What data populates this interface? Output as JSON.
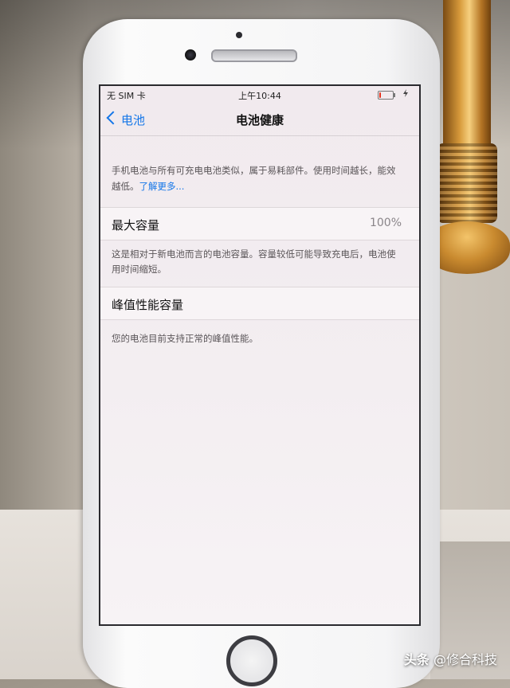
{
  "status_bar": {
    "carrier": "无 SIM 卡",
    "time": "上午10:44",
    "battery_level": 0.15,
    "battery_color": "#e5301c"
  },
  "nav": {
    "back_label": "电池",
    "title": "电池健康"
  },
  "intro": {
    "text": "手机电池与所有可充电电池类似，属于易耗部件。使用时间越长，能效越低。",
    "link": "了解更多..."
  },
  "max_capacity": {
    "label": "最大容量",
    "value": "100%",
    "description": "这是相对于新电池而言的电池容量。容量较低可能导致充电后，电池使用时间缩短。"
  },
  "peak_performance": {
    "label": "峰值性能容量",
    "description": "您的电池目前支持正常的峰值性能。"
  },
  "watermark": {
    "brand": "头条",
    "account": "@修合科技"
  },
  "colors": {
    "accent": "#1476e8"
  }
}
